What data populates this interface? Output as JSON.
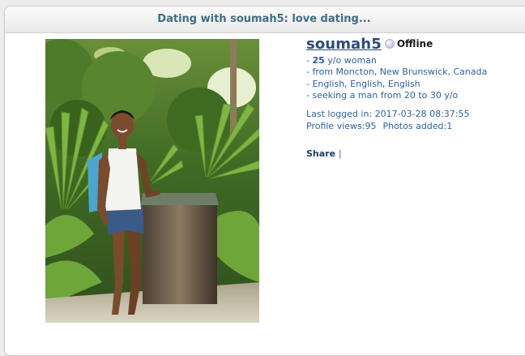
{
  "header": {
    "title": "Dating with soumah5: love dating..."
  },
  "profile": {
    "username": "soumah5",
    "status": "Offline",
    "age_prefix": "- ",
    "age": "25",
    "age_suffix": " y/o woman",
    "location": "- from Moncton, New Brunswick, Canada",
    "languages": "- English, English, English",
    "seeking": "- seeking a man from 20 to 30 y/o",
    "last_logged_label": "Last logged in:",
    "last_logged_value": "2017-03-28 08:37:55",
    "profile_views_label": "Profile views:",
    "profile_views_value": "95",
    "photos_added_label": "Photos added:",
    "photos_added_value": "1"
  },
  "actions": {
    "share_label": "Share",
    "share_separator": "|"
  },
  "photo": {
    "description": "profile photo of soumah5"
  },
  "colors": {
    "header_text": "#3f6d84",
    "link": "#2c4b7a",
    "detail_text": "#2f5fa3"
  }
}
